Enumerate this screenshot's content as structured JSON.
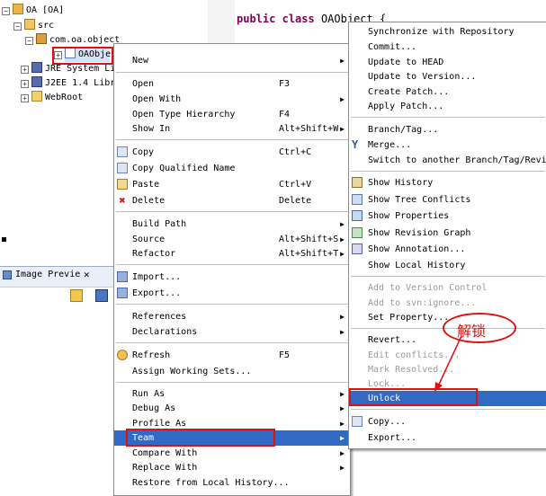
{
  "tree": {
    "project": "OA [OA]",
    "src": "src",
    "package": "com.oa.object",
    "file": "OAObje",
    "jre": "JRE System Li",
    "j2ee": "J2EE 1.4 Libr",
    "webroot": "WebRoot"
  },
  "editor": {
    "kw1": "public",
    "kw2": "class",
    "classname": "OAObject",
    "brace": "{"
  },
  "panel": {
    "title": "Image Previe"
  },
  "context_menu": {
    "items": [
      {
        "label": "New",
        "shortcut": "",
        "submenu": true
      },
      {
        "label": "Open",
        "shortcut": "F3"
      },
      {
        "label": "Open With",
        "shortcut": "",
        "submenu": true
      },
      {
        "label": "Open Type Hierarchy",
        "shortcut": "F4"
      },
      {
        "label": "Show In",
        "shortcut": "Alt+Shift+W",
        "submenu": true
      },
      {
        "label": "Copy",
        "shortcut": "Ctrl+C"
      },
      {
        "label": "Copy Qualified Name",
        "shortcut": ""
      },
      {
        "label": "Paste",
        "shortcut": "Ctrl+V"
      },
      {
        "label": "Delete",
        "shortcut": "Delete"
      },
      {
        "label": "Build Path",
        "shortcut": "",
        "submenu": true
      },
      {
        "label": "Source",
        "shortcut": "Alt+Shift+S",
        "submenu": true
      },
      {
        "label": "Refactor",
        "shortcut": "Alt+Shift+T",
        "submenu": true
      },
      {
        "label": "Import...",
        "shortcut": ""
      },
      {
        "label": "Export...",
        "shortcut": ""
      },
      {
        "label": "References",
        "shortcut": "",
        "submenu": true
      },
      {
        "label": "Declarations",
        "shortcut": "",
        "submenu": true
      },
      {
        "label": "Refresh",
        "shortcut": "F5"
      },
      {
        "label": "Assign Working Sets...",
        "shortcut": ""
      },
      {
        "label": "Run As",
        "shortcut": "",
        "submenu": true
      },
      {
        "label": "Debug As",
        "shortcut": "",
        "submenu": true
      },
      {
        "label": "Profile As",
        "shortcut": "",
        "submenu": true
      },
      {
        "label": "Team",
        "shortcut": "",
        "submenu": true
      },
      {
        "label": "Compare With",
        "shortcut": "",
        "submenu": true
      },
      {
        "label": "Replace With",
        "shortcut": "",
        "submenu": true
      },
      {
        "label": "Restore from Local History...",
        "shortcut": ""
      }
    ]
  },
  "team_menu": {
    "items": [
      {
        "label": "Synchronize with Repository"
      },
      {
        "label": "Commit..."
      },
      {
        "label": "Update to HEAD"
      },
      {
        "label": "Update to Version..."
      },
      {
        "label": "Create Patch..."
      },
      {
        "label": "Apply Patch..."
      },
      {
        "label": "Branch/Tag..."
      },
      {
        "label": "Merge..."
      },
      {
        "label": "Switch to another Branch/Tag/Revision"
      },
      {
        "label": "Show History"
      },
      {
        "label": "Show Tree Conflicts"
      },
      {
        "label": "Show Properties"
      },
      {
        "label": "Show Revision Graph"
      },
      {
        "label": "Show Annotation..."
      },
      {
        "label": "Show Local History"
      },
      {
        "label": "Add to Version Control"
      },
      {
        "label": "Add to svn:ignore..."
      },
      {
        "label": "Set Property..."
      },
      {
        "label": "Revert..."
      },
      {
        "label": "Edit conflicts..."
      },
      {
        "label": "Mark Resolved..."
      },
      {
        "label": "Lock..."
      },
      {
        "label": "Unlock"
      },
      {
        "label": "Copy..."
      },
      {
        "label": "Export..."
      }
    ]
  },
  "annotation": {
    "text": "解锁"
  },
  "colors": {
    "highlight": "#316ac5",
    "annotation": "#e01010"
  }
}
